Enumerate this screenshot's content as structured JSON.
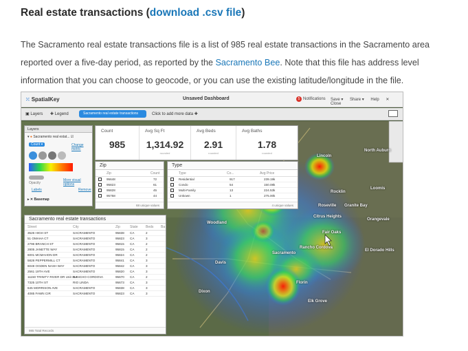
{
  "heading": {
    "text": "Real estate transactions (",
    "link": "download .csv file",
    "close": ")"
  },
  "intro": {
    "part1": "The Sacramento real estate transactions file is a list of 985 real estate transactions in the Sacramento area reported over a five-day period, as reported by the ",
    "link": "Sacramento Bee",
    "part2": ". Note that this file has address level information that you can choose to geocode, or you can use the existing latitude/longitude in the file."
  },
  "app": {
    "logo": "SpatialKey",
    "dashboard_title": "Unsaved Dashboard",
    "notifications_label": "Notifications",
    "notifications_count": "5",
    "menu": [
      "Save ▾",
      "Share ▾",
      "Help",
      "Close"
    ],
    "toolbar": {
      "layers": "Layers",
      "legend": "Legend",
      "active_tab": "Sacramento real estate transactions",
      "add_data": "Click to add more data"
    },
    "layers_panel": {
      "title": "Layers",
      "layer_name": "Sacramento real estat...",
      "count_label": "Count ▾",
      "change_metric": "Change metric",
      "opacity": "Opacity",
      "more_visual_options": "More visual options",
      "labels": "Labels",
      "remove": "Remove",
      "basemap": "Basemap"
    },
    "stats": [
      {
        "label": "Count",
        "value": "985",
        "sub": ""
      },
      {
        "label": "Avg Sq Ft",
        "value": "1,314.92",
        "sub": "rounded"
      },
      {
        "label": "Avg Beds",
        "value": "2.91",
        "sub": "rounded"
      },
      {
        "label": "Avg Baths",
        "value": "1.78",
        "sub": "rounded"
      }
    ],
    "zip_panel": {
      "title": "Zip",
      "col_zip": "Zip",
      "col_count": "Count",
      "rows": [
        {
          "zip": "95648",
          "count": "72"
        },
        {
          "zip": "95823",
          "count": "61"
        },
        {
          "zip": "95828",
          "count": "45"
        },
        {
          "zip": "95758",
          "count": "44"
        }
      ],
      "footer": "68 unique values"
    },
    "type_panel": {
      "title": "Type",
      "col_type": "Type",
      "col_count": "Co...",
      "col_price": "Avg Price",
      "rows": [
        {
          "type": "Residential",
          "count": "917",
          "price": "239.19k"
        },
        {
          "type": "Condo",
          "count": "54",
          "price": "150.08k"
        },
        {
          "type": "Multi-Family",
          "count": "13",
          "price": "224.53k"
        },
        {
          "type": "Unkown",
          "count": "1",
          "price": "275.00k"
        }
      ],
      "footer": "4 unique values"
    },
    "table_panel": {
      "title": "Sacramento real estate transactions",
      "cols": [
        "Street",
        "City",
        "Zip",
        "State",
        "Beds",
        "Ba"
      ],
      "rows": [
        [
          "3526 HIGH ST",
          "SACRAMENTO",
          "95838",
          "CA",
          "2"
        ],
        [
          "51 OMAHA CT",
          "SACRAMENTO",
          "95823",
          "CA",
          "3"
        ],
        [
          "2796 BRANCH ST",
          "SACRAMENTO",
          "95815",
          "CA",
          "2"
        ],
        [
          "2805 JANETTE WAY",
          "SACRAMENTO",
          "95815",
          "CA",
          "2"
        ],
        [
          "6001 MCMAHON DR",
          "SACRAMENTO",
          "95824",
          "CA",
          "2"
        ],
        [
          "5828 PEPPERMILL CT",
          "SACRAMENTO",
          "95841",
          "CA",
          "3"
        ],
        [
          "6048 OGDEN NASH WAY",
          "SACRAMENTO",
          "95842",
          "CA",
          "3"
        ],
        [
          "2561 19TH AVE",
          "SACRAMENTO",
          "95820",
          "CA",
          "3"
        ],
        [
          "11150 TRINITY RIVER DR Unit 114",
          "RANCHO CORDOVA",
          "95670",
          "CA",
          "2"
        ],
        [
          "7325 10TH ST",
          "RIO LINDA",
          "95673",
          "CA",
          "3"
        ],
        [
          "645 MORRISON AVE",
          "SACRAMENTO",
          "95838",
          "CA",
          "3"
        ],
        [
          "4085 FAWN CIR",
          "SACRAMENTO",
          "95823",
          "CA",
          "3"
        ]
      ],
      "footer": "985 Total Records"
    },
    "map_labels": [
      "Lincoln",
      "Rocklin",
      "Roseville",
      "Citrus Heights",
      "Orangevale",
      "Woodland",
      "Davis",
      "Sacramento",
      "Fair Oaks",
      "Rancho Cordova",
      "Elk Grove",
      "Florin",
      "North Auburn",
      "Loomis",
      "El Dorado Hills",
      "Dixon",
      "Granite Bay"
    ]
  },
  "colors": {
    "link": "#1a77b8",
    "accent": "#2a8ae0",
    "notif": "#d9342b"
  }
}
